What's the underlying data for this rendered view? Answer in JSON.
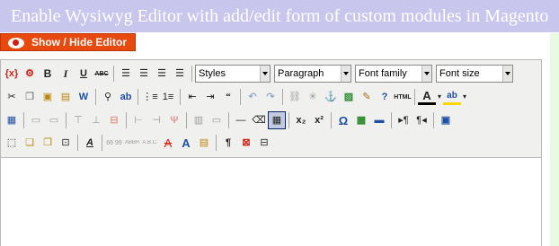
{
  "banner": {
    "title": "Enable Wysiwyg Editor with add/edit form of custom modules in Magento"
  },
  "toggle_button": {
    "label": "Show / Hide Editor"
  },
  "toolbar": {
    "row1": {
      "bold": "B",
      "italic": "I",
      "underline": "U",
      "strike": "ABC",
      "styles_select": "Styles",
      "format_select": "Paragraph",
      "fontfamily_select": "Font family",
      "fontsize_select": "Font size"
    },
    "row2": {
      "html": "HTML",
      "color_a": "A",
      "bg_ab": "ab"
    },
    "row4": {
      "sub": "x₂",
      "sup": "x²",
      "omega": "Ω",
      "font_a": "A",
      "abbr": "ABBR",
      "acronym": "A.B.C.",
      "cite": "66 99"
    }
  }
}
